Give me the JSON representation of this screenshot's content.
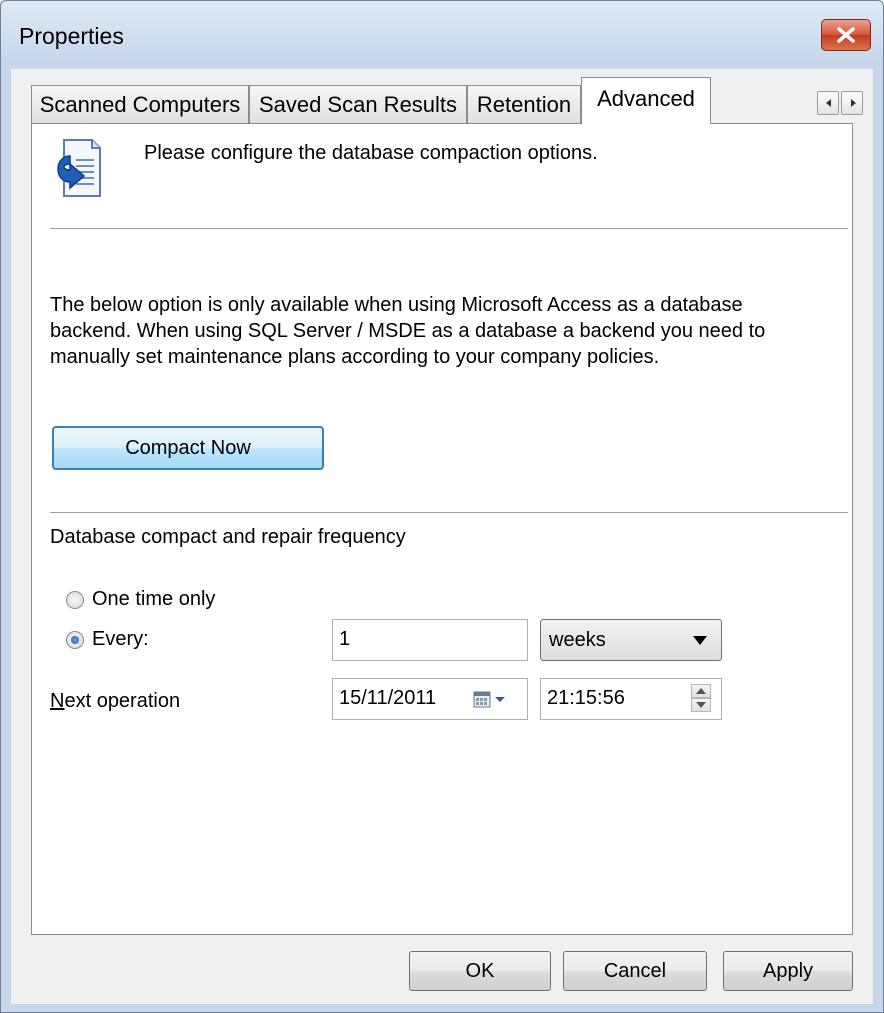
{
  "window": {
    "title": "Properties"
  },
  "tabs": [
    {
      "label": "Scanned Computers"
    },
    {
      "label": "Saved Scan Results"
    },
    {
      "label": "Retention"
    },
    {
      "label": "Advanced"
    }
  ],
  "header": {
    "text": "Please configure the database compaction options."
  },
  "description": {
    "line1": "The below option is only available when using Microsoft Access as a database",
    "line2": "backend. When using SQL Server / MSDE as a database a backend you need to",
    "line3": "manually set maintenance plans according to your company policies."
  },
  "compact_button": {
    "label": "Compact Now"
  },
  "frequency": {
    "section_label": "Database compact and repair frequency",
    "option_once": "One time only",
    "option_every": "Every:",
    "selected": "Every:",
    "every_value": "1",
    "unit": "weeks"
  },
  "next_operation": {
    "label_first": "N",
    "label_rest": "ext operation",
    "date": "15/11/2011",
    "time": "21:15:56"
  },
  "buttons": {
    "ok": "OK",
    "cancel": "Cancel",
    "apply": "Apply"
  }
}
